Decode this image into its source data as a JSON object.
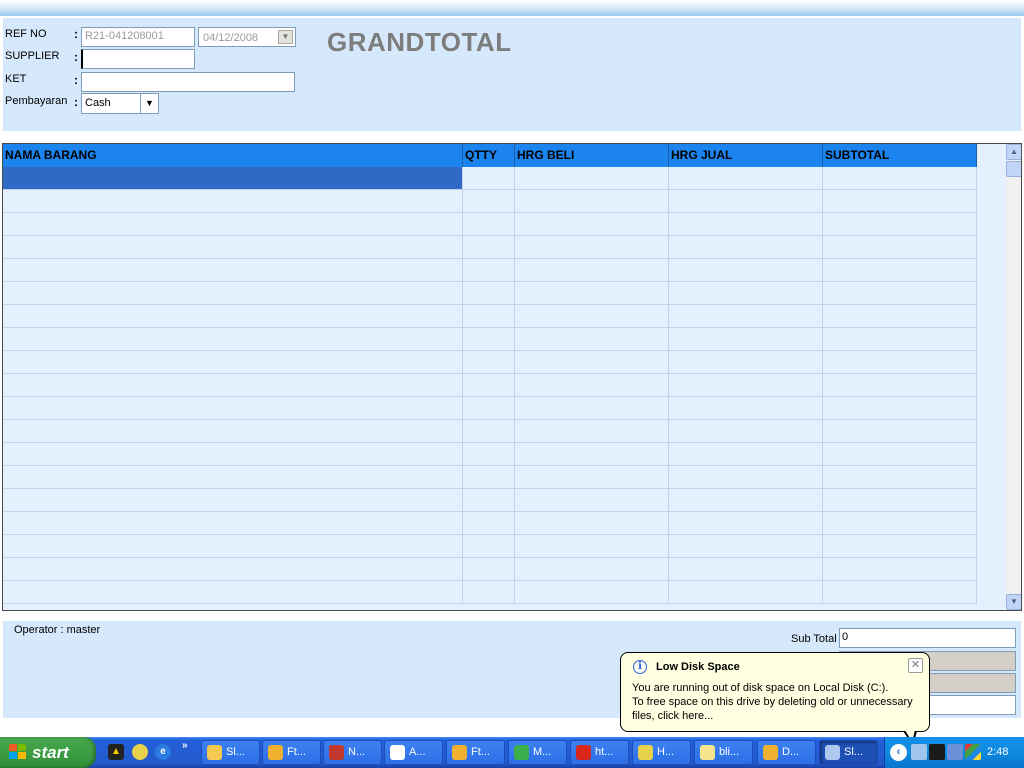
{
  "header": {
    "ref_no_label": "REF NO",
    "ref_no_value": "R21-041208001",
    "date_value": "04/12/2008",
    "supplier_label": "SUPPLIER",
    "supplier_value": "",
    "ket_label": "KET",
    "ket_value": "",
    "pembayaran_label": "Pembayaran",
    "pembayaran_value": "Cash",
    "colon": ":",
    "grandtotal_label": "GRANDTOTAL"
  },
  "grid": {
    "columns": [
      "NAMA BARANG",
      "QTTY",
      "HRG BELI",
      "HRG JUAL",
      "SUBTOTAL"
    ],
    "row_count": 19,
    "selected_row": 0
  },
  "footer": {
    "operator_text": "Operator : master",
    "subtotal_label": "Sub Total",
    "subtotal_value": "0"
  },
  "balloon": {
    "title": "Low Disk Space",
    "line1": "You are running out of disk space on Local Disk (C:).",
    "line2": "To free space on this drive by deleting old or unnecessary files, click here...",
    "info_glyph": "i",
    "close_glyph": "✕"
  },
  "taskbar": {
    "start_label": "start",
    "chevron": "»",
    "buttons": [
      {
        "label": "Sl...",
        "icon": "folder-icon",
        "color": "#f4c94f"
      },
      {
        "label": "Ft...",
        "icon": "app-7-icon",
        "color": "#f0b030"
      },
      {
        "label": "N...",
        "icon": "hs-icon",
        "color": "#c0392b"
      },
      {
        "label": "A...",
        "icon": "app-a-icon",
        "color": "#ffffff"
      },
      {
        "label": "Ft...",
        "icon": "app-7-icon",
        "color": "#f0b030"
      },
      {
        "label": "M...",
        "icon": "green-app-icon",
        "color": "#3bb04a"
      },
      {
        "label": "ht...",
        "icon": "opera-icon",
        "color": "#d8261d"
      },
      {
        "label": "H...",
        "icon": "chrome-icon",
        "color": "#e8d14a"
      },
      {
        "label": "bli...",
        "icon": "notepad-icon",
        "color": "#f5e58c"
      },
      {
        "label": "D...",
        "icon": "app-7-icon",
        "color": "#f0b030"
      },
      {
        "label": "Sl...",
        "icon": "app-gear-icon",
        "color": "#aec8f0"
      }
    ],
    "active_index": 10,
    "clock": "2:48",
    "tray_arrow": "‹"
  }
}
